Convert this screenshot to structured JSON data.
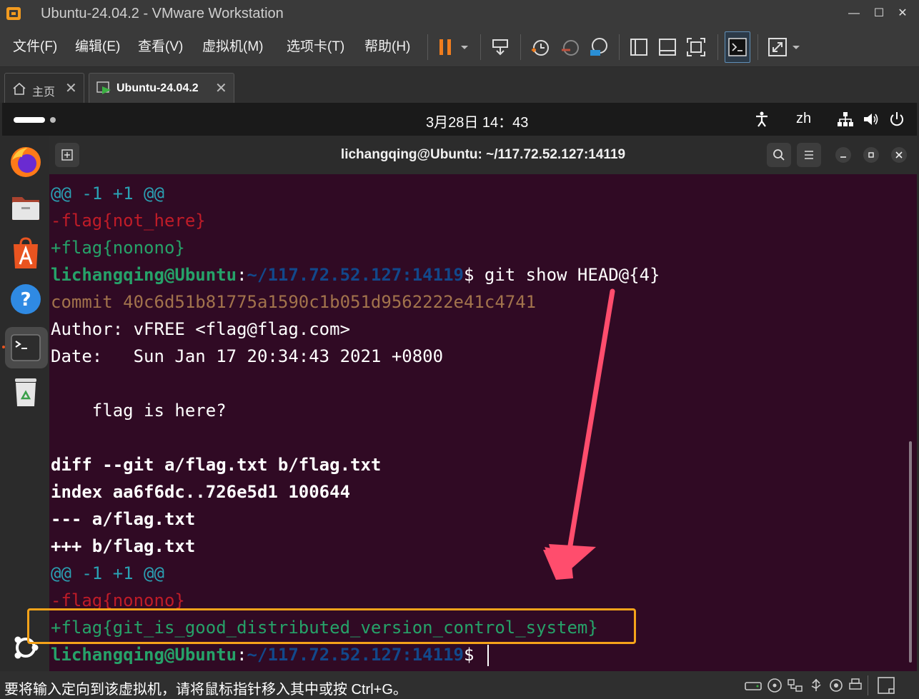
{
  "window": {
    "title": "Ubuntu-24.04.2 - VMware Workstation",
    "minimize": "—",
    "maximize": "☐",
    "close": "✕"
  },
  "menu": {
    "items": [
      "文件(F)",
      "编辑(E)",
      "查看(V)",
      "虚拟机(M)",
      "选项卡(T)",
      "帮助(H)"
    ]
  },
  "tabs": [
    {
      "label": "主页",
      "close": "✕"
    },
    {
      "label": "Ubuntu-24.04.2",
      "close": "✕"
    }
  ],
  "gnome": {
    "clock": "3月28日  14：43",
    "input_method": "zh"
  },
  "terminal": {
    "title": "lichangqing@Ubuntu: ~/117.72.52.127:14119",
    "lines": {
      "l1": "@@ -1 +1 @@",
      "l2": "-flag{not_here}",
      "l3": "+flag{nonono}",
      "p1_user": "lichangqing@Ubuntu",
      "p1_colon": ":",
      "p1_path": "~/117.72.52.127:14119",
      "p1_cmd": "$ git show HEAD@{4}",
      "l5": "commit 40c6d51b81775a1590c1b051d9562222e41c4741",
      "l6": "Author: vFREE <flag@flag.com>",
      "l7": "Date:   Sun Jan 17 20:34:43 2021 +0800",
      "l9": "    flag is here?",
      "l11": "diff --git a/flag.txt b/flag.txt",
      "l12": "index aa6f6dc..726e5d1 100644",
      "l13": "--- a/flag.txt",
      "l14": "+++ b/flag.txt",
      "l15": "@@ -1 +1 @@",
      "l16": "-flag{nonono}",
      "l17": "+flag{git_is_good_distributed_version_control_system}",
      "p2_user": "lichangqing@Ubuntu",
      "p2_colon": ":",
      "p2_path": "~/117.72.52.127:14119",
      "p2_cmd": "$ "
    }
  },
  "status": {
    "text": "要将输入定向到该虚拟机，请将鼠标指针移入其中或按 Ctrl+G。"
  },
  "colors": {
    "terminal_bg": "#300a24",
    "prompt_user": "#26a269",
    "prompt_path": "#12488b",
    "highlight": "#f5a31a",
    "arrow": "#ff4d6d"
  }
}
